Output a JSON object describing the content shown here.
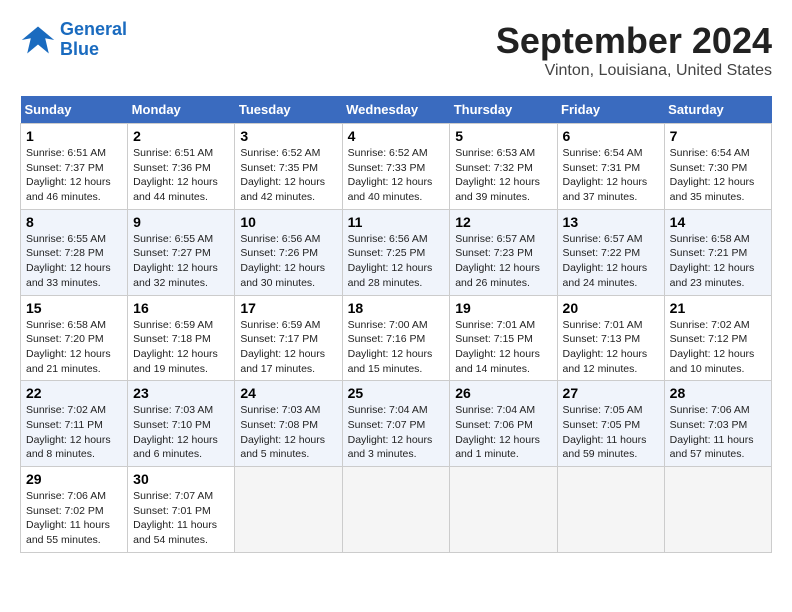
{
  "header": {
    "logo_line1": "General",
    "logo_line2": "Blue",
    "title": "September 2024",
    "subtitle": "Vinton, Louisiana, United States"
  },
  "weekdays": [
    "Sunday",
    "Monday",
    "Tuesday",
    "Wednesday",
    "Thursday",
    "Friday",
    "Saturday"
  ],
  "weeks": [
    [
      {
        "day": 1,
        "info": "Sunrise: 6:51 AM\nSunset: 7:37 PM\nDaylight: 12 hours\nand 46 minutes."
      },
      {
        "day": 2,
        "info": "Sunrise: 6:51 AM\nSunset: 7:36 PM\nDaylight: 12 hours\nand 44 minutes."
      },
      {
        "day": 3,
        "info": "Sunrise: 6:52 AM\nSunset: 7:35 PM\nDaylight: 12 hours\nand 42 minutes."
      },
      {
        "day": 4,
        "info": "Sunrise: 6:52 AM\nSunset: 7:33 PM\nDaylight: 12 hours\nand 40 minutes."
      },
      {
        "day": 5,
        "info": "Sunrise: 6:53 AM\nSunset: 7:32 PM\nDaylight: 12 hours\nand 39 minutes."
      },
      {
        "day": 6,
        "info": "Sunrise: 6:54 AM\nSunset: 7:31 PM\nDaylight: 12 hours\nand 37 minutes."
      },
      {
        "day": 7,
        "info": "Sunrise: 6:54 AM\nSunset: 7:30 PM\nDaylight: 12 hours\nand 35 minutes."
      }
    ],
    [
      {
        "day": 8,
        "info": "Sunrise: 6:55 AM\nSunset: 7:28 PM\nDaylight: 12 hours\nand 33 minutes."
      },
      {
        "day": 9,
        "info": "Sunrise: 6:55 AM\nSunset: 7:27 PM\nDaylight: 12 hours\nand 32 minutes."
      },
      {
        "day": 10,
        "info": "Sunrise: 6:56 AM\nSunset: 7:26 PM\nDaylight: 12 hours\nand 30 minutes."
      },
      {
        "day": 11,
        "info": "Sunrise: 6:56 AM\nSunset: 7:25 PM\nDaylight: 12 hours\nand 28 minutes."
      },
      {
        "day": 12,
        "info": "Sunrise: 6:57 AM\nSunset: 7:23 PM\nDaylight: 12 hours\nand 26 minutes."
      },
      {
        "day": 13,
        "info": "Sunrise: 6:57 AM\nSunset: 7:22 PM\nDaylight: 12 hours\nand 24 minutes."
      },
      {
        "day": 14,
        "info": "Sunrise: 6:58 AM\nSunset: 7:21 PM\nDaylight: 12 hours\nand 23 minutes."
      }
    ],
    [
      {
        "day": 15,
        "info": "Sunrise: 6:58 AM\nSunset: 7:20 PM\nDaylight: 12 hours\nand 21 minutes."
      },
      {
        "day": 16,
        "info": "Sunrise: 6:59 AM\nSunset: 7:18 PM\nDaylight: 12 hours\nand 19 minutes."
      },
      {
        "day": 17,
        "info": "Sunrise: 6:59 AM\nSunset: 7:17 PM\nDaylight: 12 hours\nand 17 minutes."
      },
      {
        "day": 18,
        "info": "Sunrise: 7:00 AM\nSunset: 7:16 PM\nDaylight: 12 hours\nand 15 minutes."
      },
      {
        "day": 19,
        "info": "Sunrise: 7:01 AM\nSunset: 7:15 PM\nDaylight: 12 hours\nand 14 minutes."
      },
      {
        "day": 20,
        "info": "Sunrise: 7:01 AM\nSunset: 7:13 PM\nDaylight: 12 hours\nand 12 minutes."
      },
      {
        "day": 21,
        "info": "Sunrise: 7:02 AM\nSunset: 7:12 PM\nDaylight: 12 hours\nand 10 minutes."
      }
    ],
    [
      {
        "day": 22,
        "info": "Sunrise: 7:02 AM\nSunset: 7:11 PM\nDaylight: 12 hours\nand 8 minutes."
      },
      {
        "day": 23,
        "info": "Sunrise: 7:03 AM\nSunset: 7:10 PM\nDaylight: 12 hours\nand 6 minutes."
      },
      {
        "day": 24,
        "info": "Sunrise: 7:03 AM\nSunset: 7:08 PM\nDaylight: 12 hours\nand 5 minutes."
      },
      {
        "day": 25,
        "info": "Sunrise: 7:04 AM\nSunset: 7:07 PM\nDaylight: 12 hours\nand 3 minutes."
      },
      {
        "day": 26,
        "info": "Sunrise: 7:04 AM\nSunset: 7:06 PM\nDaylight: 12 hours\nand 1 minute."
      },
      {
        "day": 27,
        "info": "Sunrise: 7:05 AM\nSunset: 7:05 PM\nDaylight: 11 hours\nand 59 minutes."
      },
      {
        "day": 28,
        "info": "Sunrise: 7:06 AM\nSunset: 7:03 PM\nDaylight: 11 hours\nand 57 minutes."
      }
    ],
    [
      {
        "day": 29,
        "info": "Sunrise: 7:06 AM\nSunset: 7:02 PM\nDaylight: 11 hours\nand 55 minutes."
      },
      {
        "day": 30,
        "info": "Sunrise: 7:07 AM\nSunset: 7:01 PM\nDaylight: 11 hours\nand 54 minutes."
      },
      null,
      null,
      null,
      null,
      null
    ]
  ]
}
